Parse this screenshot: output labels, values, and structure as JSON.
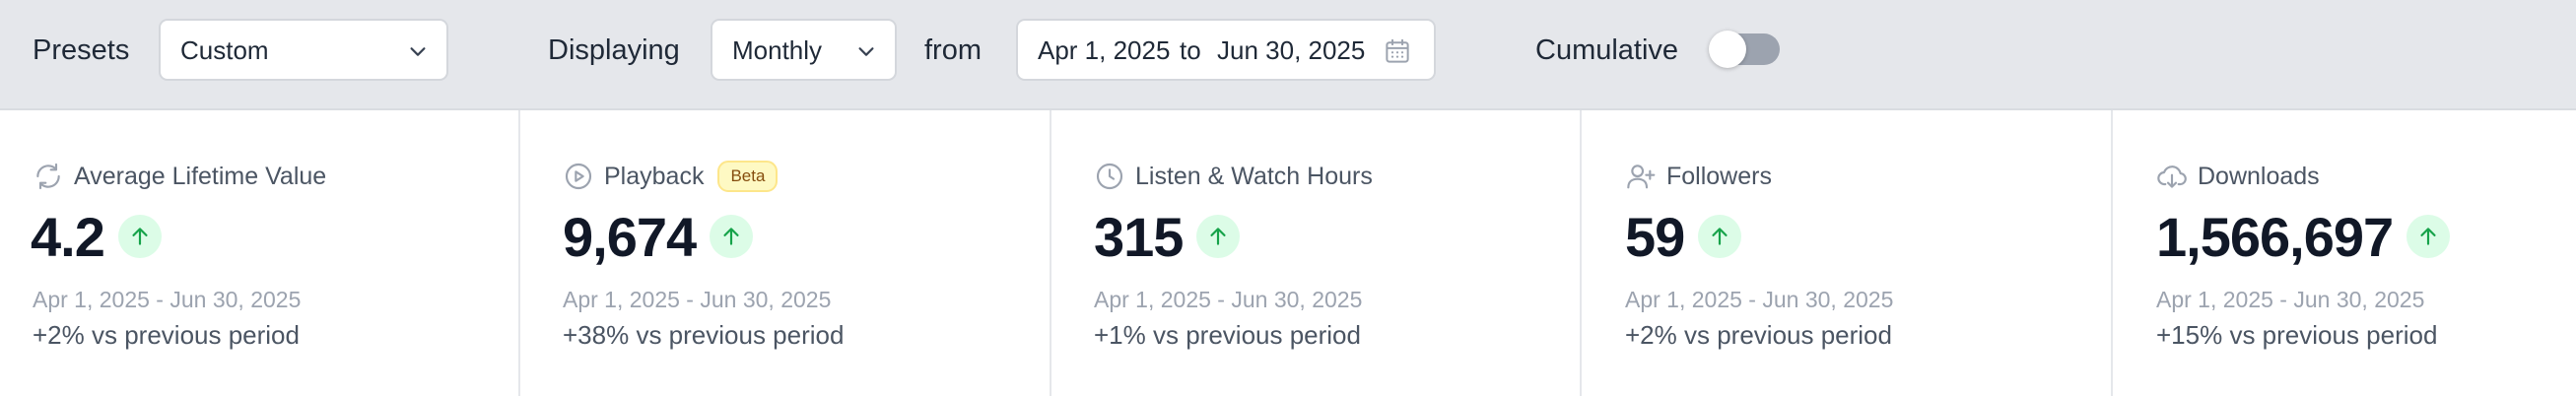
{
  "filters": {
    "presets_label": "Presets",
    "preset_value": "Custom",
    "displaying_label": "Displaying",
    "displaying_value": "Monthly",
    "from_label": "from",
    "date_start": "Apr 1, 2025",
    "date_separator": "to",
    "date_end": "Jun 30, 2025",
    "cumulative_label": "Cumulative",
    "cumulative_on": false
  },
  "cards": [
    {
      "title": "Average Lifetime Value",
      "icon": "refresh-icon",
      "value": "4.2",
      "trend": "up",
      "range": "Apr 1, 2025 - Jun 30, 2025",
      "change": "+2% vs previous period"
    },
    {
      "title": "Playback",
      "icon": "play-circle-icon",
      "badge": "Beta",
      "value": "9,674",
      "trend": "up",
      "range": "Apr 1, 2025 - Jun 30, 2025",
      "change": "+38% vs previous period"
    },
    {
      "title": "Listen & Watch Hours",
      "icon": "clock-icon",
      "value": "315",
      "trend": "up",
      "range": "Apr 1, 2025 - Jun 30, 2025",
      "change": "+1% vs previous period"
    },
    {
      "title": "Followers",
      "icon": "user-plus-icon",
      "value": "59",
      "trend": "up",
      "range": "Apr 1, 2025 - Jun 30, 2025",
      "change": "+2% vs previous period"
    },
    {
      "title": "Downloads",
      "icon": "download-cloud-icon",
      "value": "1,566,697",
      "trend": "up",
      "range": "Apr 1, 2025 - Jun 30, 2025",
      "change": "+15% vs previous period"
    }
  ],
  "colors": {
    "toolbar_bg": "#e5e7eb",
    "trend_up_bg": "#dcfce7",
    "trend_up_fg": "#16a34a",
    "beta_bg": "#fef9c3",
    "toggle_off": "#9ca3af"
  }
}
